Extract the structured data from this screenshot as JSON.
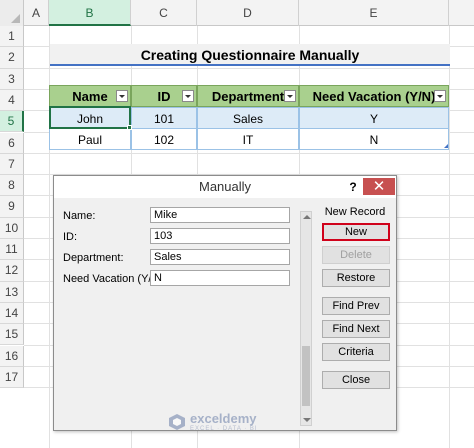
{
  "sheet": {
    "columns": [
      "A",
      "B",
      "C",
      "D",
      "E"
    ],
    "rows": [
      "1",
      "2",
      "3",
      "4",
      "5",
      "6",
      "7",
      "8",
      "9",
      "10",
      "11",
      "12",
      "13",
      "14",
      "15",
      "16",
      "17"
    ],
    "title": "Creating Questionnaire Manually",
    "table": {
      "headers": [
        "Name",
        "ID",
        "Department",
        "Need Vacation (Y/N)"
      ],
      "rows": [
        [
          "John",
          "101",
          "Sales",
          "Y"
        ],
        [
          "Paul",
          "102",
          "IT",
          "N"
        ]
      ]
    }
  },
  "dialog": {
    "title": "Manually",
    "help_label": "?",
    "close_label": "✕",
    "record_status": "New Record",
    "fields": [
      {
        "label": "Name:",
        "value": "Mike"
      },
      {
        "label": "ID:",
        "value": "103"
      },
      {
        "label": "Department:",
        "value": "Sales"
      },
      {
        "label": "Need Vacation (Y/N):",
        "value": "N"
      }
    ],
    "buttons": {
      "new": "New",
      "delete": "Delete",
      "restore": "Restore",
      "find_prev": "Find Prev",
      "find_next": "Find Next",
      "criteria": "Criteria",
      "close": "Close"
    }
  },
  "watermark": {
    "name": "exceldemy",
    "tagline": "EXCEL · DATA · BI"
  },
  "colors": {
    "header_green": "#a9d08e",
    "row_blue": "#ddebf7",
    "selection_green": "#217346",
    "close_red": "#c75050",
    "focus_red": "#d0021b"
  }
}
